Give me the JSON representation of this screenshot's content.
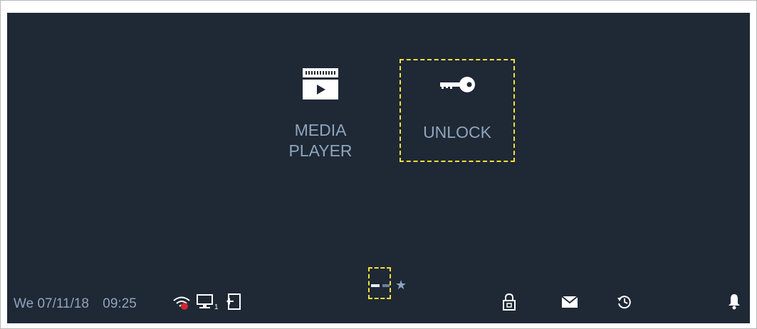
{
  "tiles": {
    "media_player": {
      "label_line1": "MEDIA",
      "label_line2": "PLAYER",
      "icon": "media-player-icon"
    },
    "unlock": {
      "label": "UNLOCK",
      "icon": "key-icon"
    }
  },
  "pager": {
    "pages": 2,
    "active_page": 1,
    "favorites_icon": "star-icon"
  },
  "status_bar": {
    "day": "We",
    "date": "07/11/18",
    "time": "09:25",
    "network_monitor_count": "1",
    "icons": [
      "wifi-disconnected-icon",
      "monitor-icon",
      "door-exit-icon",
      "lock-icon",
      "envelope-icon",
      "history-icon",
      "bell-icon"
    ]
  },
  "colors": {
    "background": "#1f2835",
    "label": "#8fa5bd",
    "highlight": "#f2e23a",
    "alert": "#d0262d",
    "icon_white": "#ffffff"
  }
}
